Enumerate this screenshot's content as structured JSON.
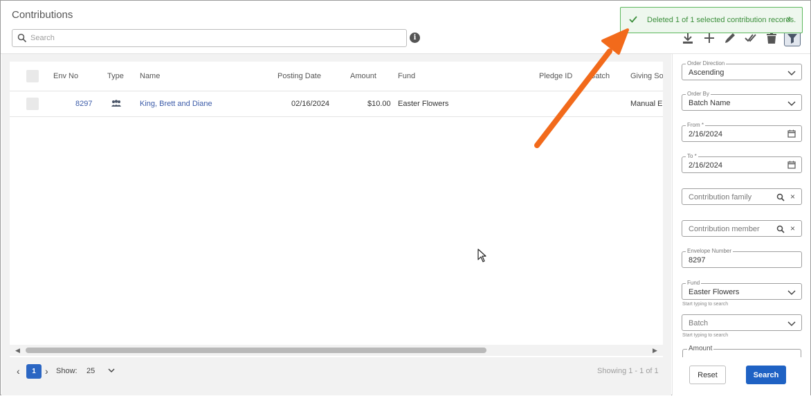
{
  "header": {
    "title": "Contributions",
    "search_placeholder": "Search",
    "info_glyph": "i"
  },
  "toast": {
    "message": "Deleted 1 of 1 selected contribution records.",
    "close_glyph": "×",
    "color": "#3c8f3c"
  },
  "toolbar": {
    "icons": [
      "download-icon",
      "plus-icon",
      "pencil-icon",
      "double-check-icon",
      "trash-icon",
      "filter-icon"
    ]
  },
  "table": {
    "columns": {
      "env_no": "Env No",
      "type": "Type",
      "name": "Name",
      "posting_date": "Posting Date",
      "amount": "Amount",
      "fund": "Fund",
      "pledge_id": "Pledge ID",
      "batch": "Batch",
      "giving_source": "Giving Source"
    },
    "rows": [
      {
        "env_no": "8297",
        "type_icon": "family-icon",
        "name": "King, Brett and Diane",
        "posting_date": "02/16/2024",
        "amount": "$10.00",
        "fund": "Easter Flowers",
        "pledge_id": "",
        "batch": "",
        "giving_source": "Manual Entry"
      }
    ]
  },
  "pagination": {
    "current_page": "1",
    "show_label": "Show:",
    "page_size": "25",
    "showing_text": "Showing 1 - 1 of 1"
  },
  "filters": {
    "order_direction": {
      "label": "Order Direction",
      "value": "Ascending"
    },
    "order_by": {
      "label": "Order By",
      "value": "Batch Name"
    },
    "from": {
      "label": "From *",
      "value": "2/16/2024"
    },
    "to": {
      "label": "To *",
      "value": "2/16/2024"
    },
    "contribution_family": {
      "placeholder": "Contribution family"
    },
    "contribution_member": {
      "placeholder": "Contribution member"
    },
    "envelope_number": {
      "label": "Envelope Number",
      "value": "8297"
    },
    "fund": {
      "label": "Fund",
      "value": "Easter Flowers",
      "hint": "Start typing to search"
    },
    "batch": {
      "placeholder": "Batch",
      "hint": "Start typing to search"
    },
    "amount": {
      "label": "Amount"
    },
    "reset_label": "Reset",
    "search_label": "Search"
  },
  "colors": {
    "primary": "#1f62c4",
    "link": "#3a5aa8",
    "annotation_arrow": "#f26a1b"
  }
}
